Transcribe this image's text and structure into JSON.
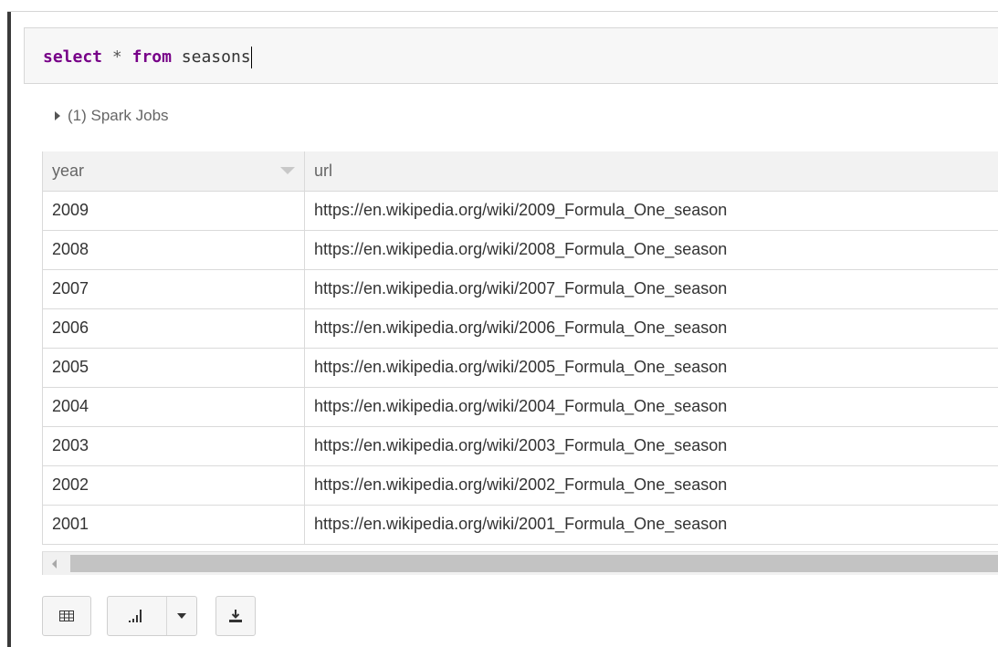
{
  "editor": {
    "keyword_select": "select",
    "operator": "*",
    "keyword_from": "from",
    "table_name": "seasons"
  },
  "spark_jobs": {
    "label": "(1) Spark Jobs"
  },
  "table": {
    "headers": [
      "year",
      "url"
    ],
    "rows": [
      [
        "2009",
        "https://en.wikipedia.org/wiki/2009_Formula_One_season"
      ],
      [
        "2008",
        "https://en.wikipedia.org/wiki/2008_Formula_One_season"
      ],
      [
        "2007",
        "https://en.wikipedia.org/wiki/2007_Formula_One_season"
      ],
      [
        "2006",
        "https://en.wikipedia.org/wiki/2006_Formula_One_season"
      ],
      [
        "2005",
        "https://en.wikipedia.org/wiki/2005_Formula_One_season"
      ],
      [
        "2004",
        "https://en.wikipedia.org/wiki/2004_Formula_One_season"
      ],
      [
        "2003",
        "https://en.wikipedia.org/wiki/2003_Formula_One_season"
      ],
      [
        "2002",
        "https://en.wikipedia.org/wiki/2002_Formula_One_season"
      ],
      [
        "2001",
        "https://en.wikipedia.org/wiki/2001_Formula_One_season"
      ]
    ]
  },
  "toolbar": {
    "table_icon": "table-grid-icon",
    "chart_icon": "bar-chart-icon",
    "dropdown_icon": "caret-down-icon",
    "download_icon": "download-icon"
  },
  "colors": {
    "keyword": "#770088",
    "header_bg": "#f2f2f2",
    "scrollbar_thumb": "#c3c3c3"
  }
}
